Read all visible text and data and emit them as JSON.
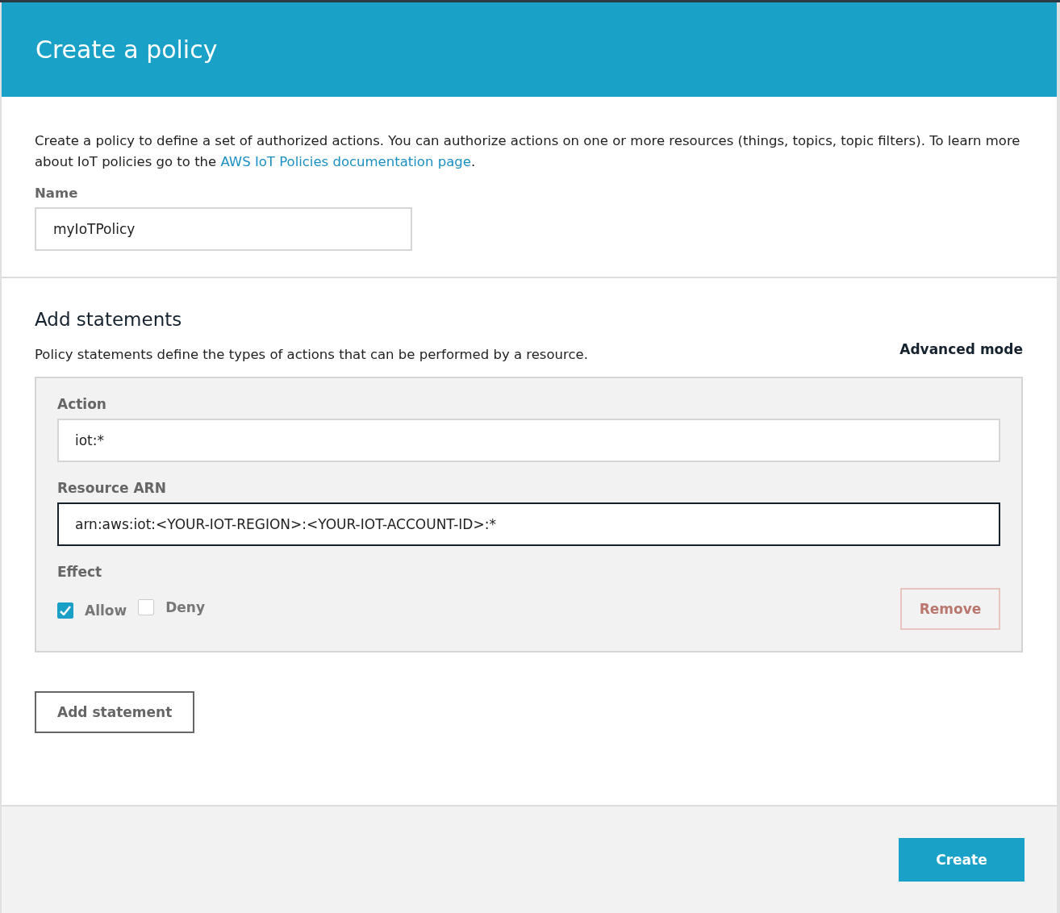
{
  "header": {
    "title": "Create a policy"
  },
  "intro": {
    "text": "Create a policy to define a set of authorized actions. You can authorize actions on one or more resources (things, topics, topic filters). To learn more about IoT policies go to the ",
    "link": "AWS IoT Policies documentation page",
    "after": "."
  },
  "name_field": {
    "label": "Name",
    "value": "myIoTPolicy"
  },
  "statements": {
    "title": "Add statements",
    "description": "Policy statements define the types of actions that can be performed by a resource.",
    "advanced_mode": "Advanced mode",
    "items": [
      {
        "action_label": "Action",
        "action_value": "iot:*",
        "resource_label": "Resource ARN",
        "resource_value": "arn:aws:iot:<YOUR-IOT-REGION>:<YOUR-IOT-ACCOUNT-ID>:*",
        "resource_focused": true,
        "effect_label": "Effect",
        "effects": [
          {
            "label": "Allow",
            "checked": true
          },
          {
            "label": "Deny",
            "checked": false
          }
        ],
        "remove": {
          "label": "Remove",
          "disabled": true
        }
      }
    ],
    "add_button": "Add statement"
  },
  "footer": {
    "create_button": "Create"
  }
}
